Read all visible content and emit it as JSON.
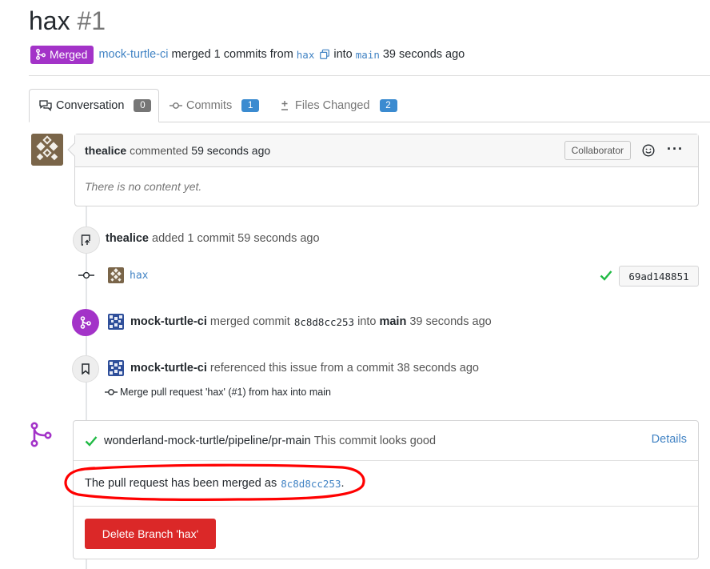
{
  "header": {
    "title": "hax",
    "number": "#1",
    "status_label": "Merged",
    "merger": "mock-turtle-ci",
    "merged_text": "merged 1 commits from",
    "head_branch": "hax",
    "into_text": "into",
    "base_branch": "main",
    "time_ago": "39 seconds ago"
  },
  "tabs": [
    {
      "label": "Conversation",
      "count": "0"
    },
    {
      "label": "Commits",
      "count": "1"
    },
    {
      "label": "Files Changed",
      "count": "2"
    }
  ],
  "comment": {
    "author": "thealice",
    "action": "commented",
    "time": "59 seconds ago",
    "role_badge": "Collaborator",
    "body": "There is no content yet."
  },
  "events": {
    "added_commit": {
      "author": "thealice",
      "text": "added 1 commit",
      "time": "59 seconds ago"
    },
    "commit_row": {
      "message": "hax",
      "sha": "69ad148851"
    },
    "merged": {
      "author": "mock-turtle-ci",
      "text": "merged commit",
      "sha": "8c8d8cc253",
      "into": "into",
      "branch": "main",
      "time": "39 seconds ago"
    },
    "referenced": {
      "author": "mock-turtle-ci",
      "text": "referenced this issue from a commit",
      "time": "38 seconds ago",
      "commit_message": "Merge pull request 'hax' (#1) from hax into main"
    }
  },
  "merge_box": {
    "status_context": "wonderland-mock-turtle/pipeline/pr-main",
    "status_text": "This commit looks good",
    "details_label": "Details",
    "merged_message": "The pull request has been merged as",
    "merged_sha": "8c8d8cc253",
    "merged_suffix": ".",
    "delete_button_label": "Delete Branch 'hax'"
  },
  "colors": {
    "merged_purple": "#a333c8",
    "link_blue": "#4183c4",
    "danger_red": "#db2828",
    "success_green": "#21ba45",
    "annotation_red": "#ff0000"
  }
}
